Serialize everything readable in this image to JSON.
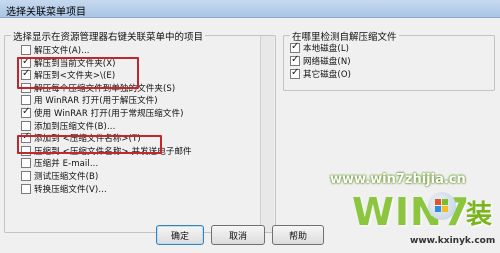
{
  "window": {
    "title": "选择关联菜单项目"
  },
  "left_group": {
    "legend": "选择显示在资源管理器右键关联菜单中的项目",
    "items": [
      {
        "label": "解压文件(A)...",
        "checked": false
      },
      {
        "label": "解压到当前文件夹(X)",
        "checked": true
      },
      {
        "label": "解压到<文件夹>\\(E)",
        "checked": true
      },
      {
        "label": "解压每个压缩文件到单独的文件夹(S)",
        "checked": false
      },
      {
        "label": "用 WinRAR 打开(用于解压文件)",
        "checked": false
      },
      {
        "label": "使用 WinRAR 打开(用于常规压缩文件)",
        "checked": true
      },
      {
        "label": "添加到压缩文件(B)...",
        "checked": false
      },
      {
        "label": "添加到 <压缩文件名称>(T)",
        "checked": true
      },
      {
        "label": "压缩到 <压缩文件名称> 并发送电子邮件",
        "checked": false
      },
      {
        "label": "压缩并 E-mail...",
        "checked": false
      },
      {
        "label": "测试压缩文件(B)",
        "checked": false
      },
      {
        "label": "转换压缩文件(V)...",
        "checked": false
      }
    ]
  },
  "right_group": {
    "legend": "在哪里检测自解压缩文件",
    "items": [
      {
        "label": "本地磁盘(L)",
        "checked": true
      },
      {
        "label": "网络磁盘(N)",
        "checked": true
      },
      {
        "label": "其它磁盘(O)",
        "checked": true
      }
    ]
  },
  "buttons": {
    "ok": "确定",
    "cancel": "取消",
    "help": "帮助"
  },
  "watermark": {
    "site": "www.win7zhijia.cn",
    "site2": "www.kxinyk.com",
    "brand": "WIN7",
    "brand2": "装"
  },
  "colors": {
    "highlight": "#c4262e",
    "watermark_green": "#7ab51d"
  }
}
